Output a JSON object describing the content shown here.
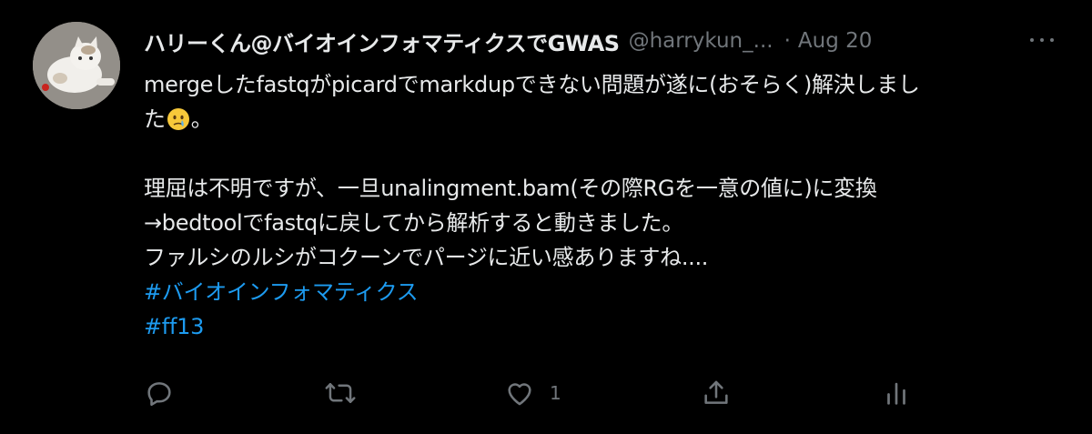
{
  "tweet": {
    "display_name": "ハリーくん@バイオインフォマティクスでGWAS",
    "handle": "@harrykun_...",
    "dot": "·",
    "date": "Aug 20",
    "avatar_icon": "cat-avatar-icon",
    "body": {
      "line1": "mergeしたfastqがpicardでmarkdupできない問題が遂に(おそらく)解決しまし",
      "line2_pre": "た",
      "line2_emoji": "face-holding-back-tears-emoji",
      "line2_post": "。",
      "line3": "理屈は不明ですが、一旦unalingment.bam(その際RGを一意の値に)に変換",
      "line4": "→bedtoolでfastqに戻してから解析すると動きました。",
      "line5": "ファルシのルシがコクーンでパージに近い感ありますね...."
    },
    "hashtags": [
      "#バイオインフォマティクス",
      "#ff13"
    ],
    "actions": {
      "reply_icon": "reply-icon",
      "retweet_icon": "retweet-icon",
      "like_icon": "heart-icon",
      "like_count": "1",
      "share_icon": "share-icon",
      "analytics_icon": "analytics-icon"
    },
    "more_icon": "more-options-icon"
  },
  "colors": {
    "background": "#000000",
    "text": "#e7e9ea",
    "secondary": "#71767b",
    "link": "#1d9bf0"
  }
}
